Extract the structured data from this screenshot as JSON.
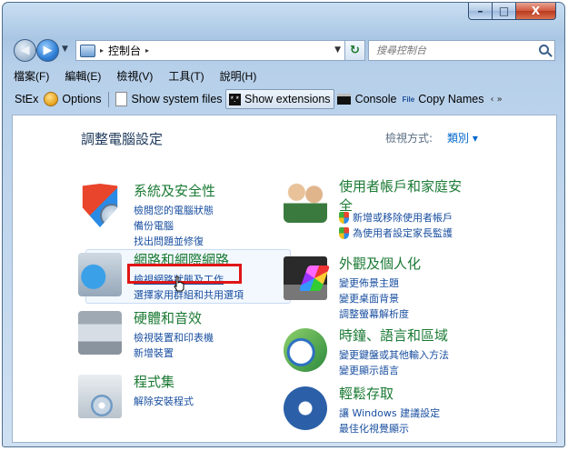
{
  "window": {
    "min_label": "–",
    "max_label": "□",
    "close_label": "X"
  },
  "navbar": {
    "breadcrumb_arrow": "▸",
    "address": "控制台",
    "address_trailing_arrow": "▸",
    "search_placeholder": "搜尋控制台"
  },
  "menubar": {
    "items": [
      "檔案(F)",
      "編輯(E)",
      "檢視(V)",
      "工具(T)",
      "說明(H)"
    ]
  },
  "toolbar": {
    "items": [
      "StEx",
      "Options",
      "Show system files",
      "Show extensions",
      "Console",
      "Copy Names"
    ],
    "ext_badge": "*.*",
    "more": "‹ »"
  },
  "content": {
    "title": "調整電腦設定",
    "view_by_label": "檢視方式:",
    "view_by_value": "類別 ▾",
    "categories": [
      {
        "title": "系統及安全性",
        "links": [
          "檢閱您的電腦狀態",
          "備份電腦",
          "找出問題並修復"
        ]
      },
      {
        "title": "網路和網際網路",
        "links": [
          "檢視網路狀態及工作",
          "選擇家用群組和共用選項"
        ]
      },
      {
        "title": "硬體和音效",
        "links": [
          "檢視裝置和印表機",
          "新增裝置"
        ]
      },
      {
        "title": "程式集",
        "links": [
          "解除安裝程式"
        ]
      },
      {
        "title_line1": "使用者帳戶和家庭安",
        "title_line2": "全",
        "links": [
          "新增或移除使用者帳戶",
          "為使用者設定家長監護"
        ]
      },
      {
        "title": "外觀及個人化",
        "links": [
          "變更佈景主題",
          "變更桌面背景",
          "調整螢幕解析度"
        ]
      },
      {
        "title": "時鐘、語言和區域",
        "links": [
          "變更鍵盤或其他輸入方法",
          "變更顯示語言"
        ]
      },
      {
        "title": "輕鬆存取",
        "links": [
          "讓 Windows 建議設定",
          "最佳化視覺顯示"
        ]
      }
    ]
  }
}
